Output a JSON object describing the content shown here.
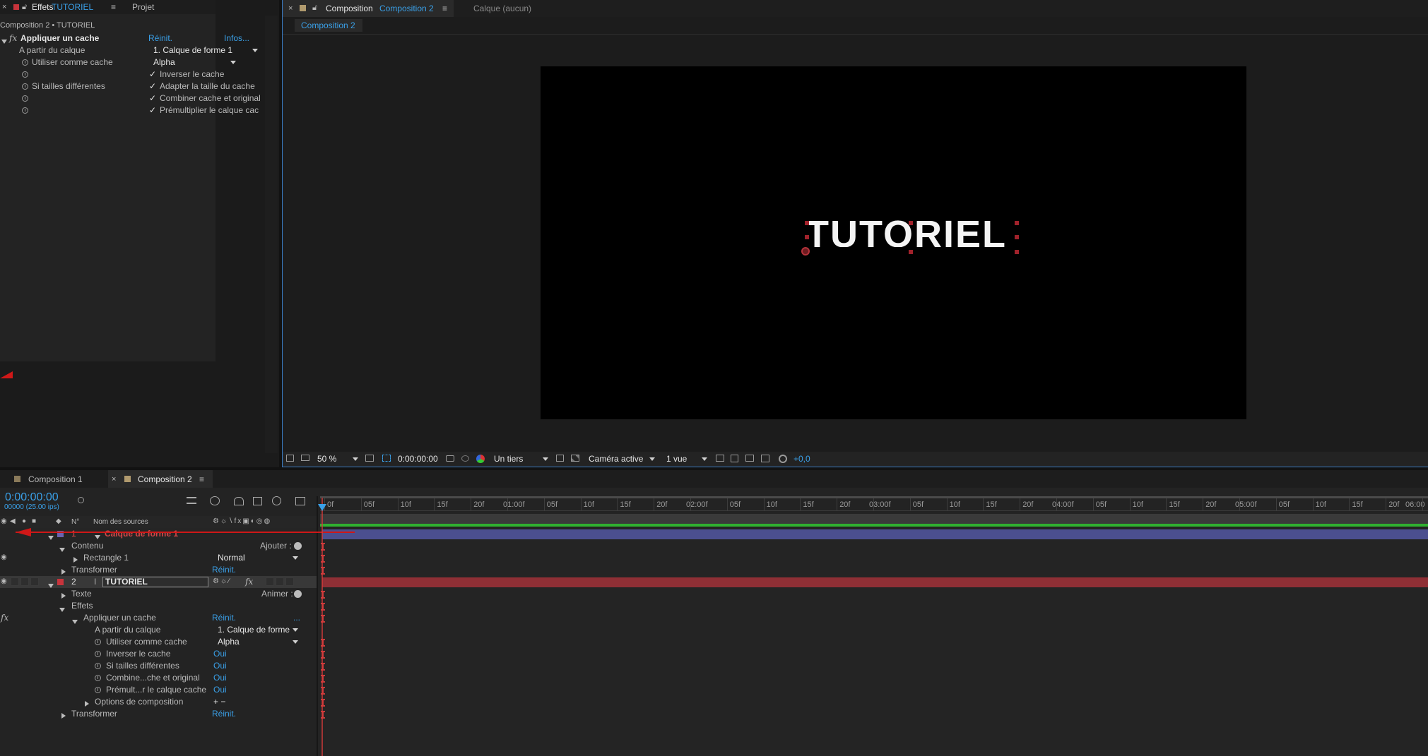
{
  "effects_panel": {
    "tab_close": "×",
    "tab_label": "Effets",
    "tab_layer": "TUTORIEL",
    "tab_menu": "≡",
    "project_tab": "Projet",
    "breadcrumb": "Composition 2 • TUTORIEL",
    "effect_name": "Appliquer un cache",
    "reset": "Réinit.",
    "infos": "Infos...",
    "props": [
      {
        "label": "A partir du calque",
        "value": "1. Calque de forme 1"
      },
      {
        "label": "Utiliser comme cache",
        "value": "Alpha"
      },
      {
        "label": "",
        "value": "Inverser le cache"
      },
      {
        "label": "Si tailles différentes",
        "value": "Adapter la taille du cache"
      },
      {
        "label": "",
        "value": "Combiner cache et original"
      },
      {
        "label": "",
        "value": "Prémultiplier le calque cac"
      }
    ],
    "check": "✓"
  },
  "viewer": {
    "tab_close": "×",
    "tab_label": "Composition",
    "tab_comp": "Composition 2",
    "tab_menu": "≡",
    "layer_tab": "Calque  (aucun)",
    "sub_tab": "Composition 2",
    "canvas_text": "TUTORIEL",
    "zoom": "50 %",
    "timecode": "0:00:00:00",
    "resolution": "Un tiers",
    "camera": "Caméra active",
    "views": "1 vue",
    "exposure": "+0,0"
  },
  "timeline": {
    "tabs": [
      {
        "label": "Composition 1"
      },
      {
        "label": "Composition 2",
        "close": "×",
        "menu": "≡"
      }
    ],
    "timecode": "0:00:00:00",
    "frames": "00000 (25.00 ips)",
    "col_num": "N°",
    "col_name": "Nom des sources",
    "ruler": [
      "0f",
      "05f",
      "10f",
      "15f",
      "20f",
      "01:00f",
      "05f",
      "10f",
      "15f",
      "20f",
      "02:00f",
      "05f",
      "10f",
      "15f",
      "20f",
      "03:00f",
      "05f",
      "10f",
      "15f",
      "20f",
      "04:00f",
      "05f",
      "10f",
      "15f",
      "20f",
      "05:00f",
      "05f",
      "10f",
      "15f",
      "20f",
      "06:00"
    ],
    "layer1": {
      "num": "1",
      "name": "Calque de forme 1",
      "contents": "Contenu",
      "add": "Ajouter :",
      "rect": "Rectangle 1",
      "blend": "Normal",
      "transform": "Transformer",
      "reset": "Réinit."
    },
    "layer2": {
      "num": "2",
      "name": "TUTORIEL",
      "text": "Texte",
      "animate": "Animer :",
      "effects": "Effets",
      "fx": "fx",
      "effect_name": "Appliquer un cache",
      "reset": "Réinit.",
      "more": "...",
      "props": [
        {
          "label": "A partir du calque",
          "value": "1. Calque de forme"
        },
        {
          "label": "Utiliser comme cache",
          "value": "Alpha"
        },
        {
          "label": "Inverser le cache",
          "value": "Oui"
        },
        {
          "label": "Si tailles différentes",
          "value": "Oui"
        },
        {
          "label": "Combine...che et original",
          "value": "Oui"
        },
        {
          "label": "Prémult...r le calque cache",
          "value": "Oui"
        }
      ],
      "options": "Options de composition",
      "plusminus": "+ −",
      "transform": "Transformer",
      "transform_reset": "Réinit."
    }
  },
  "colors": {
    "accent": "#3aa0e8",
    "layer1_bar": "#4b4f8f",
    "layer2_bar": "#8f2f35",
    "label_red": "#c8343c",
    "label_purple": "#6b63b0"
  }
}
